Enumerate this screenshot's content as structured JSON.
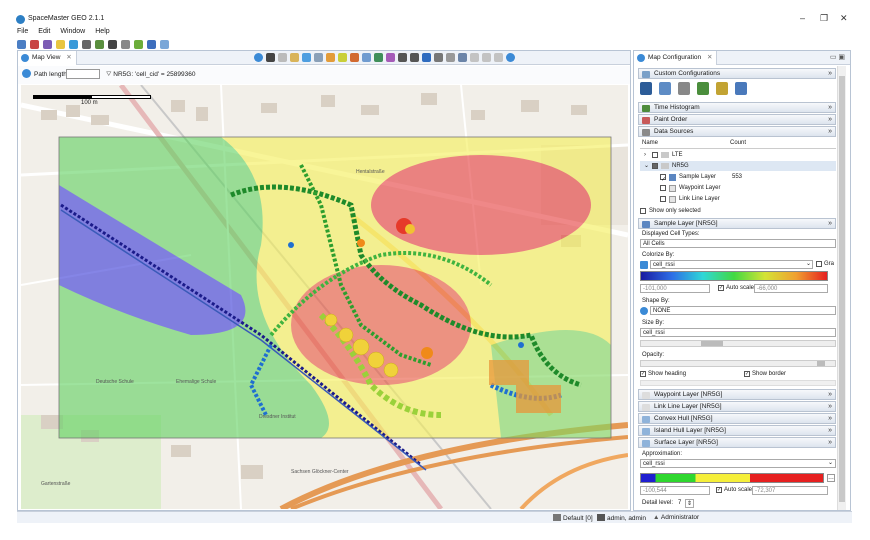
{
  "app": {
    "title": "SpaceMaster GEO 2.1.1",
    "window_controls": [
      "–",
      "❐",
      "✕"
    ]
  },
  "menu": [
    "File",
    "Edit",
    "Window",
    "Help"
  ],
  "map_view": {
    "tab_label": "Map View",
    "close": "✕",
    "path_length_label": "Path length:",
    "path_length_value": "",
    "filter_info": "NR5G: 'cell_cid' = 25899360",
    "scale_label": "100 m"
  },
  "map_labels": [
    {
      "text": "Hentalstraße"
    },
    {
      "text": "Gartenstraße"
    },
    {
      "text": "Deutsche Schule"
    },
    {
      "text": "Ehemalige Schule"
    },
    {
      "text": "Dresdner Institut"
    },
    {
      "text": "Sachsen Glöckner-Center"
    }
  ],
  "panel": {
    "tab_label": "Map Configuration",
    "close": "✕",
    "sections": {
      "custom": "Custom Configurations",
      "time_histogram": "Time Histogram",
      "paint_order": "Paint Order",
      "data_sources": "Data Sources",
      "sample_layer": "Sample Layer [NR5G]",
      "waypoint_layer": "Waypoint Layer [NR5G]",
      "link_line_layer": "Link Line Layer [NR5G]",
      "convex_hull": "Convex Hull [NR5G]",
      "island_hull": "Island Hull Layer [NR5G]",
      "surface_layer": "Surface Layer [NR5G]"
    },
    "table": {
      "col_name": "Name",
      "col_count": "Count",
      "rows": [
        {
          "name": "LTE",
          "count": ""
        },
        {
          "name": "NR5G",
          "count": ""
        },
        {
          "name": "Sample Layer",
          "count": "553"
        },
        {
          "name": "Waypoint Layer",
          "count": ""
        },
        {
          "name": "Link Line Layer",
          "count": ""
        }
      ]
    },
    "show_only_selected": "Show only selected",
    "sample": {
      "displayed_cell_types_label": "Displayed Cell Types:",
      "displayed_cell_types_value": "All Cells",
      "colorize_by_label": "Colorize By:",
      "colorize_by_value": "cell_rssi",
      "gradient_toggle": "Gra",
      "ramp_min": "-101,000",
      "ramp_max": "-66,000",
      "auto_scale": "Auto scale",
      "shape_by_label": "Shape By:",
      "shape_by_value": "NONE",
      "size_by_label": "Size By:",
      "size_by_value": "cell_rssi",
      "opacity_label": "Opacity:",
      "show_heading": "Show heading",
      "show_border": "Show border"
    },
    "surface": {
      "approximation_label": "Approximation:",
      "approximation_value": "cell_rssi",
      "ramp_min": "-100,544",
      "ramp_max": "-72,307",
      "auto_scale": "Auto scale",
      "detail_level_label": "Detail level:",
      "detail_level_value": "7"
    }
  },
  "status": {
    "default": "Default [0]",
    "user": "admin, admin",
    "role": "Administrator"
  },
  "colors": {
    "accent": "#3b8ad6",
    "surface_red": "#e64040",
    "surface_yellow": "#f5ef5a",
    "surface_green": "#63d263",
    "surface_blue": "#3c3cd8"
  }
}
